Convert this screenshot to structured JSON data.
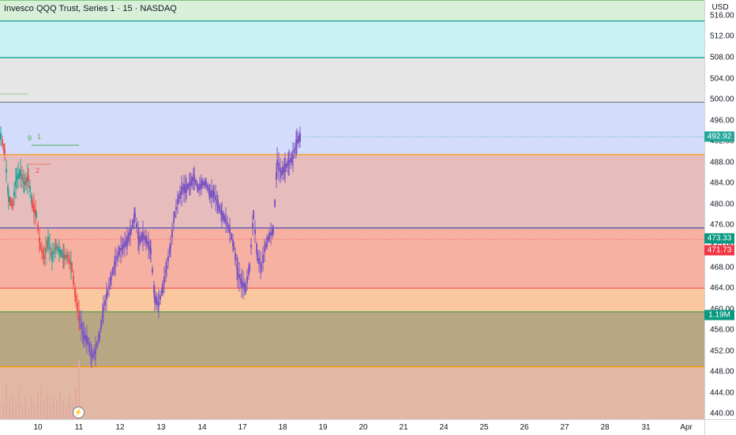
{
  "header": {
    "symbol_title": "Invesco QQQ Trust, Series 1 · 15 · NASDAQ"
  },
  "price_axis": {
    "currency": "USD",
    "ticks": [
      "516.00",
      "512.00",
      "508.00",
      "504.00",
      "500.00",
      "496.00",
      "492.00",
      "488.00",
      "484.00",
      "480.00",
      "476.00",
      "472.00",
      "468.00",
      "464.00",
      "460.00",
      "456.00",
      "452.00",
      "448.00",
      "444.00",
      "440.00"
    ]
  },
  "time_axis": {
    "ticks": [
      "10",
      "11",
      "12",
      "13",
      "14",
      "17",
      "18",
      "19",
      "20",
      "21",
      "24",
      "25",
      "26",
      "27",
      "28",
      "31",
      "Apr"
    ]
  },
  "price_tags": {
    "last_price": "492.92",
    "level_a": "473.33",
    "level_b": "471.73",
    "volume": "1.19M"
  },
  "colors": {
    "zone_green": "#d8f0d8",
    "zone_cyan": "#c9f2f2",
    "zone_gray": "#e6e6e6",
    "zone_blue": "#d3dcfb",
    "zone_pink": "#e6bcbc",
    "zone_salmon": "#f6b1a3",
    "zone_orange": "#fbc79f",
    "zone_olive": "#b9a883",
    "zone_tan": "#e1b8a3",
    "line_green": "#4caf50",
    "line_teal": "#009688",
    "line_gray": "#787b86",
    "line_orange": "#ff9800",
    "line_blue": "#3f51b5",
    "line_red": "#ef5350",
    "line_dkgreen": "#43a047",
    "candle": "#7e57c2",
    "tag_last": "#26a69a",
    "tag_red": "#f23645",
    "tag_green": "#089981",
    "volume_bar": "#e0a8a3"
  },
  "annotations": {
    "td_labels": [
      "9",
      "1",
      "2"
    ]
  },
  "chart_data": {
    "type": "candlestick",
    "symbol": "QQQ",
    "interval": "15",
    "ylim": [
      439,
      519
    ],
    "zones": [
      {
        "from": 515,
        "to": 519,
        "color": "zone_green"
      },
      {
        "from": 508,
        "to": 515,
        "color": "zone_cyan"
      },
      {
        "from": 499.5,
        "to": 508,
        "color": "zone_gray"
      },
      {
        "from": 489.5,
        "to": 499.5,
        "color": "zone_blue"
      },
      {
        "from": 475.5,
        "to": 489.5,
        "color": "zone_pink"
      },
      {
        "from": 464,
        "to": 475.5,
        "color": "zone_salmon"
      },
      {
        "from": 459.5,
        "to": 464,
        "color": "zone_orange"
      },
      {
        "from": 449,
        "to": 459.5,
        "color": "zone_olive"
      },
      {
        "from": 439,
        "to": 449,
        "color": "zone_tan"
      }
    ],
    "levels": [
      {
        "price": 519,
        "color": "line_green"
      },
      {
        "price": 515,
        "color": "line_teal"
      },
      {
        "price": 508,
        "color": "line_teal"
      },
      {
        "price": 499.5,
        "color": "line_gray"
      },
      {
        "price": 489.5,
        "color": "line_orange"
      },
      {
        "price": 475.5,
        "color": "line_blue"
      },
      {
        "price": 464,
        "color": "line_red"
      },
      {
        "price": 459.5,
        "color": "line_dkgreen"
      },
      {
        "price": 449,
        "color": "line_orange"
      }
    ],
    "price_path": [
      [
        0,
        493
      ],
      [
        5,
        490
      ],
      [
        10,
        481
      ],
      [
        15,
        480
      ],
      [
        20,
        485
      ],
      [
        25,
        486
      ],
      [
        30,
        484
      ],
      [
        35,
        485
      ],
      [
        40,
        480
      ],
      [
        45,
        478
      ],
      [
        50,
        472
      ],
      [
        55,
        470
      ],
      [
        60,
        473
      ],
      [
        65,
        470
      ],
      [
        70,
        472
      ],
      [
        75,
        471
      ],
      [
        80,
        470
      ],
      [
        85,
        470
      ],
      [
        90,
        468
      ],
      [
        95,
        462
      ],
      [
        100,
        458
      ],
      [
        105,
        455
      ],
      [
        110,
        454
      ],
      [
        115,
        451
      ],
      [
        120,
        452
      ],
      [
        125,
        455
      ],
      [
        130,
        460
      ],
      [
        135,
        463
      ],
      [
        140,
        466
      ],
      [
        145,
        469
      ],
      [
        150,
        471
      ],
      [
        155,
        472
      ],
      [
        160,
        473
      ],
      [
        165,
        475
      ],
      [
        170,
        478
      ],
      [
        175,
        473
      ],
      [
        180,
        474
      ],
      [
        185,
        473
      ],
      [
        190,
        471
      ],
      [
        195,
        462
      ],
      [
        200,
        461
      ],
      [
        205,
        464
      ],
      [
        210,
        468
      ],
      [
        215,
        472
      ],
      [
        220,
        478
      ],
      [
        225,
        481
      ],
      [
        230,
        483
      ],
      [
        235,
        483
      ],
      [
        240,
        484
      ],
      [
        245,
        485
      ],
      [
        250,
        483
      ],
      [
        255,
        484
      ],
      [
        260,
        484
      ],
      [
        265,
        482
      ],
      [
        270,
        482
      ],
      [
        275,
        480
      ],
      [
        280,
        478
      ],
      [
        285,
        477
      ],
      [
        290,
        475
      ],
      [
        295,
        472
      ],
      [
        300,
        467
      ],
      [
        305,
        465
      ],
      [
        310,
        464
      ],
      [
        315,
        468
      ],
      [
        320,
        478
      ],
      [
        325,
        470
      ],
      [
        330,
        468
      ],
      [
        335,
        472
      ],
      [
        340,
        474
      ],
      [
        345,
        475
      ],
      [
        350,
        488
      ],
      [
        355,
        486
      ],
      [
        360,
        487
      ],
      [
        365,
        488
      ],
      [
        370,
        489
      ],
      [
        375,
        492
      ],
      [
        380,
        493
      ]
    ],
    "volume_bars": [
      [
        3,
        20
      ],
      [
        7,
        45
      ],
      [
        11,
        25
      ],
      [
        15,
        30
      ],
      [
        19,
        22
      ],
      [
        23,
        40
      ],
      [
        27,
        18
      ],
      [
        31,
        26
      ],
      [
        35,
        15
      ],
      [
        39,
        28
      ],
      [
        43,
        20
      ],
      [
        47,
        36
      ],
      [
        51,
        42
      ],
      [
        55,
        24
      ],
      [
        59,
        32
      ],
      [
        63,
        20
      ],
      [
        67,
        28
      ],
      [
        71,
        22
      ],
      [
        75,
        34
      ],
      [
        79,
        25
      ],
      [
        83,
        18
      ],
      [
        87,
        30
      ],
      [
        91,
        22
      ],
      [
        95,
        40
      ],
      [
        99,
        75
      ]
    ]
  }
}
